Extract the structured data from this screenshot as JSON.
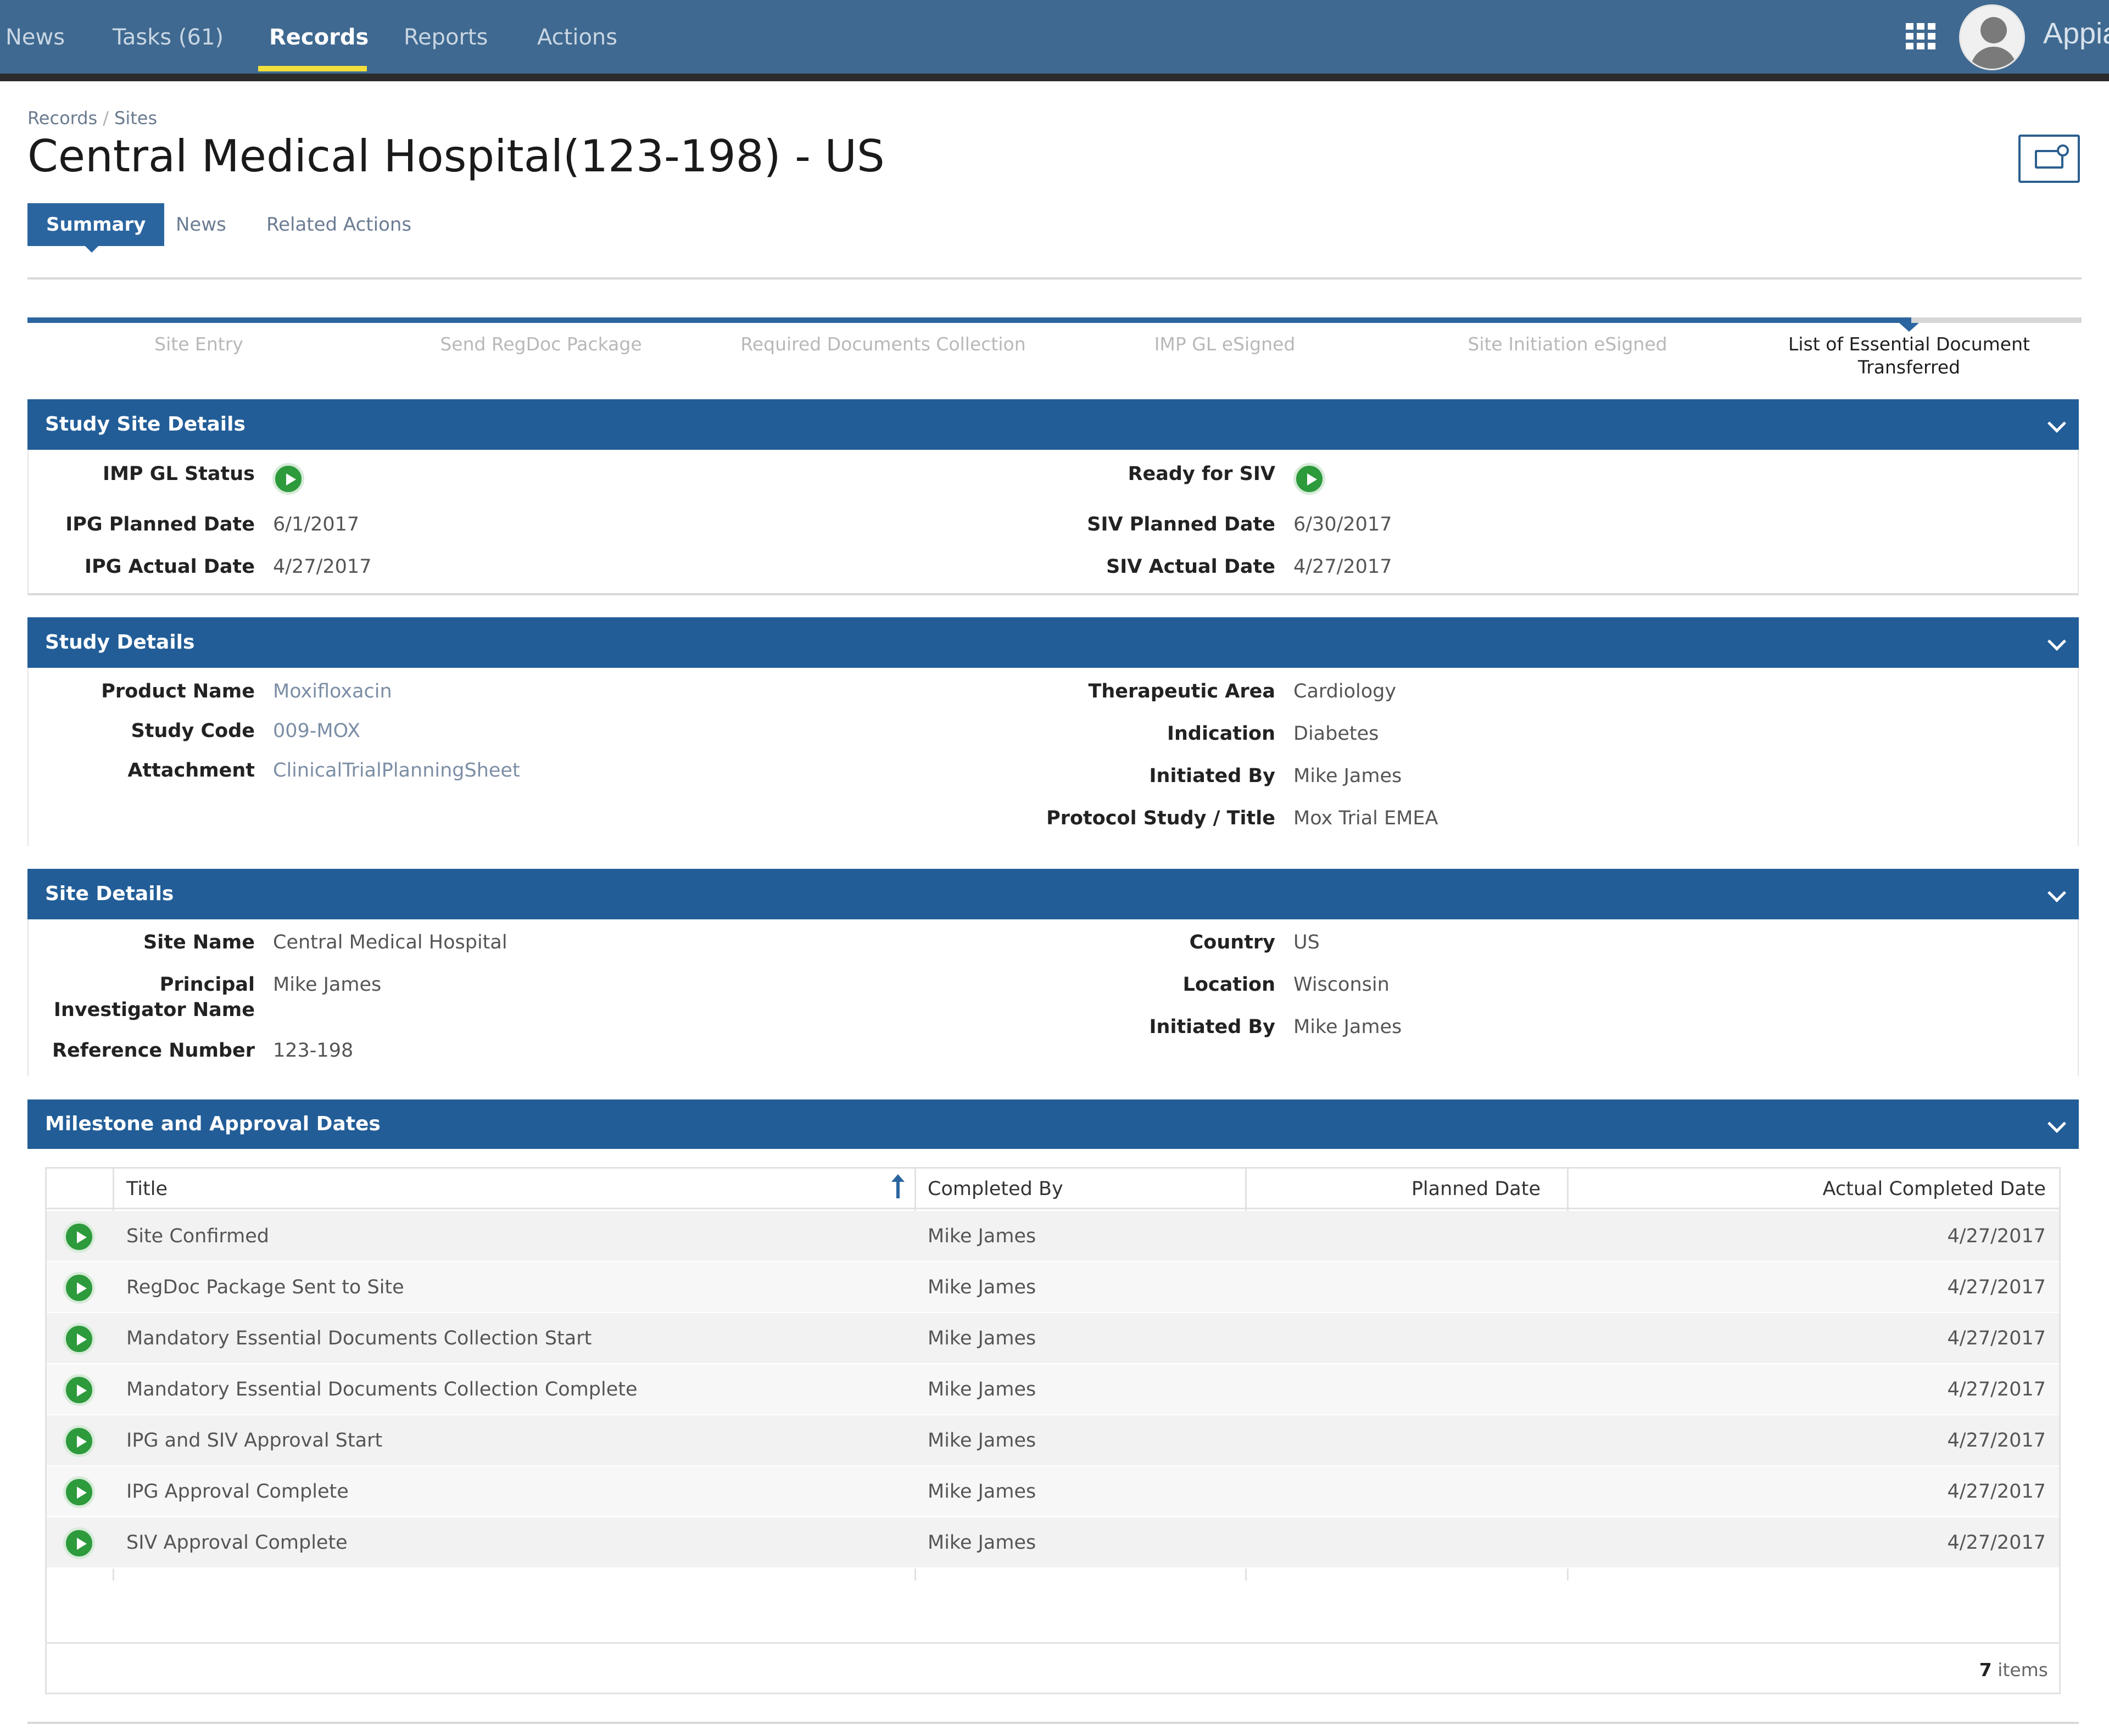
{
  "topnav": {
    "items": [
      "News",
      "Tasks (61)",
      "Records",
      "Reports",
      "Actions"
    ],
    "active": "Records",
    "brand": "Appian",
    "colors": {
      "bar": "#3f6990",
      "active_underline": "#f3df3c"
    }
  },
  "header": {
    "breadcrumb": [
      "Records",
      "Sites"
    ],
    "breadcrumb_sep": "/",
    "title": "Central Medical Hospital(123-198) - US"
  },
  "tabs": [
    "Summary",
    "News",
    "Related Actions"
  ],
  "milestones": {
    "steps": [
      "Site Entry",
      "Send RegDoc Package",
      "Required Documents Collection",
      "IMP GL eSigned",
      "Site Initiation eSigned",
      "List of Essential Document Transferred"
    ],
    "current_index": 5
  },
  "study_site_details": {
    "title": "Study Site Details",
    "left": [
      {
        "label": "IMP GL Status",
        "value": ""
      },
      {
        "label": "IPG Planned Date",
        "value": "6/1/2017"
      },
      {
        "label": "IPG Actual Date",
        "value": "4/27/2017"
      }
    ],
    "right": [
      {
        "label": "Ready for SIV",
        "value": ""
      },
      {
        "label": "SIV Planned Date",
        "value": "6/30/2017"
      },
      {
        "label": "SIV Actual Date",
        "value": "4/27/2017"
      }
    ]
  },
  "study_details": {
    "title": "Study Details",
    "left": [
      {
        "label": "Product Name",
        "value": "Moxifloxacin"
      },
      {
        "label": "Study Code",
        "value": "009-MOX"
      },
      {
        "label": "Attachment",
        "value": "ClinicalTrialPlanningSheet"
      }
    ],
    "right": [
      {
        "label": "Therapeutic Area",
        "value": "Cardiology"
      },
      {
        "label": "Indication",
        "value": "Diabetes"
      },
      {
        "label": "Initiated By",
        "value": "Mike James"
      },
      {
        "label": "Protocol Study / Title",
        "value": "Mox Trial EMEA"
      }
    ]
  },
  "site_details": {
    "title": "Site Details",
    "left": [
      {
        "label": "Site Name",
        "value": "Central Medical Hospital"
      },
      {
        "label": "Principal Investigator Name",
        "value": "Mike James"
      },
      {
        "label": "Reference Number",
        "value": "123-198"
      }
    ],
    "right": [
      {
        "label": "Country",
        "value": "US"
      },
      {
        "label": "Location",
        "value": "Wisconsin"
      },
      {
        "label": "Initiated By",
        "value": "Mike James"
      }
    ]
  },
  "milestone_dates": {
    "title": "Milestone and Approval Dates",
    "columns": [
      "Title",
      "Completed By",
      "Planned Date",
      "Actual Completed Date"
    ],
    "rows": [
      {
        "title": "Site Confirmed",
        "completed_by": "Mike James",
        "planned": "",
        "actual": "4/27/2017"
      },
      {
        "title": "RegDoc Package Sent to Site",
        "completed_by": "Mike James",
        "planned": "",
        "actual": "4/27/2017"
      },
      {
        "title": "Mandatory Essential Documents Collection Start",
        "completed_by": "Mike James",
        "planned": "",
        "actual": "4/27/2017"
      },
      {
        "title": "Mandatory Essential Documents Collection Complete",
        "completed_by": "Mike James",
        "planned": "",
        "actual": "4/27/2017"
      },
      {
        "title": "IPG and SIV Approval Start",
        "completed_by": "Mike James",
        "planned": "",
        "actual": "4/27/2017"
      },
      {
        "title": "IPG Approval Complete",
        "completed_by": "Mike James",
        "planned": "",
        "actual": "4/27/2017"
      },
      {
        "title": "SIV Approval Complete",
        "completed_by": "Mike James",
        "planned": "",
        "actual": "4/27/2017"
      }
    ],
    "count": "7",
    "count_suffix": "items"
  },
  "icons": {
    "status": "play-circle-icon",
    "apps": "grid-icon",
    "settings": "record-settings-icon",
    "collapse": "chevron-down-icon"
  }
}
